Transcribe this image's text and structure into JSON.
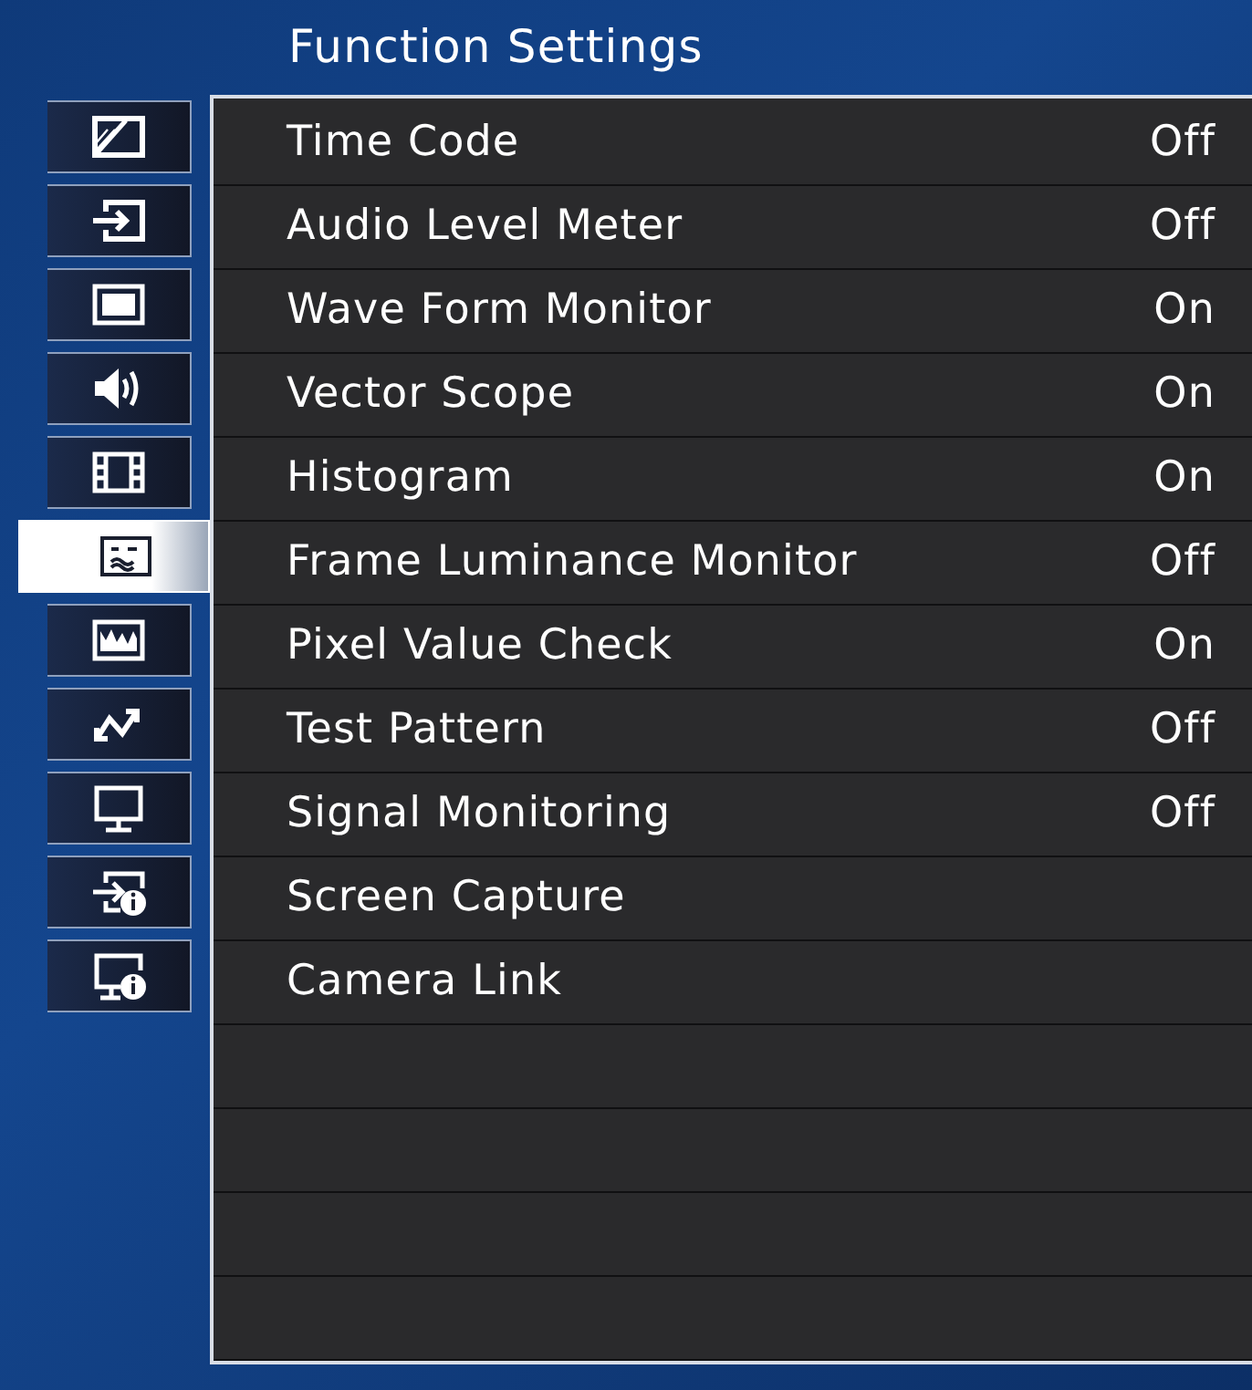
{
  "title": "Function Settings",
  "sidebar": {
    "items": [
      {
        "kind": "picture-adjust",
        "selected": false
      },
      {
        "kind": "input",
        "selected": false
      },
      {
        "kind": "screen",
        "selected": false
      },
      {
        "kind": "audio",
        "selected": false
      },
      {
        "kind": "marker",
        "selected": false
      },
      {
        "kind": "function",
        "selected": true
      },
      {
        "kind": "waveform",
        "selected": false
      },
      {
        "kind": "link",
        "selected": false
      },
      {
        "kind": "display",
        "selected": false
      },
      {
        "kind": "input-info",
        "selected": false
      },
      {
        "kind": "display-info",
        "selected": false
      }
    ]
  },
  "menu": {
    "items": [
      {
        "label": "Time Code",
        "value": "Off"
      },
      {
        "label": "Audio Level Meter",
        "value": "Off"
      },
      {
        "label": "Wave Form Monitor",
        "value": "On"
      },
      {
        "label": "Vector Scope",
        "value": "On"
      },
      {
        "label": "Histogram",
        "value": "On"
      },
      {
        "label": "Frame Luminance Monitor",
        "value": "Off"
      },
      {
        "label": "Pixel Value Check",
        "value": "On"
      },
      {
        "label": "Test Pattern",
        "value": "Off"
      },
      {
        "label": "Signal Monitoring",
        "value": "Off"
      },
      {
        "label": "Screen Capture"
      },
      {
        "label": "Camera Link"
      }
    ]
  }
}
